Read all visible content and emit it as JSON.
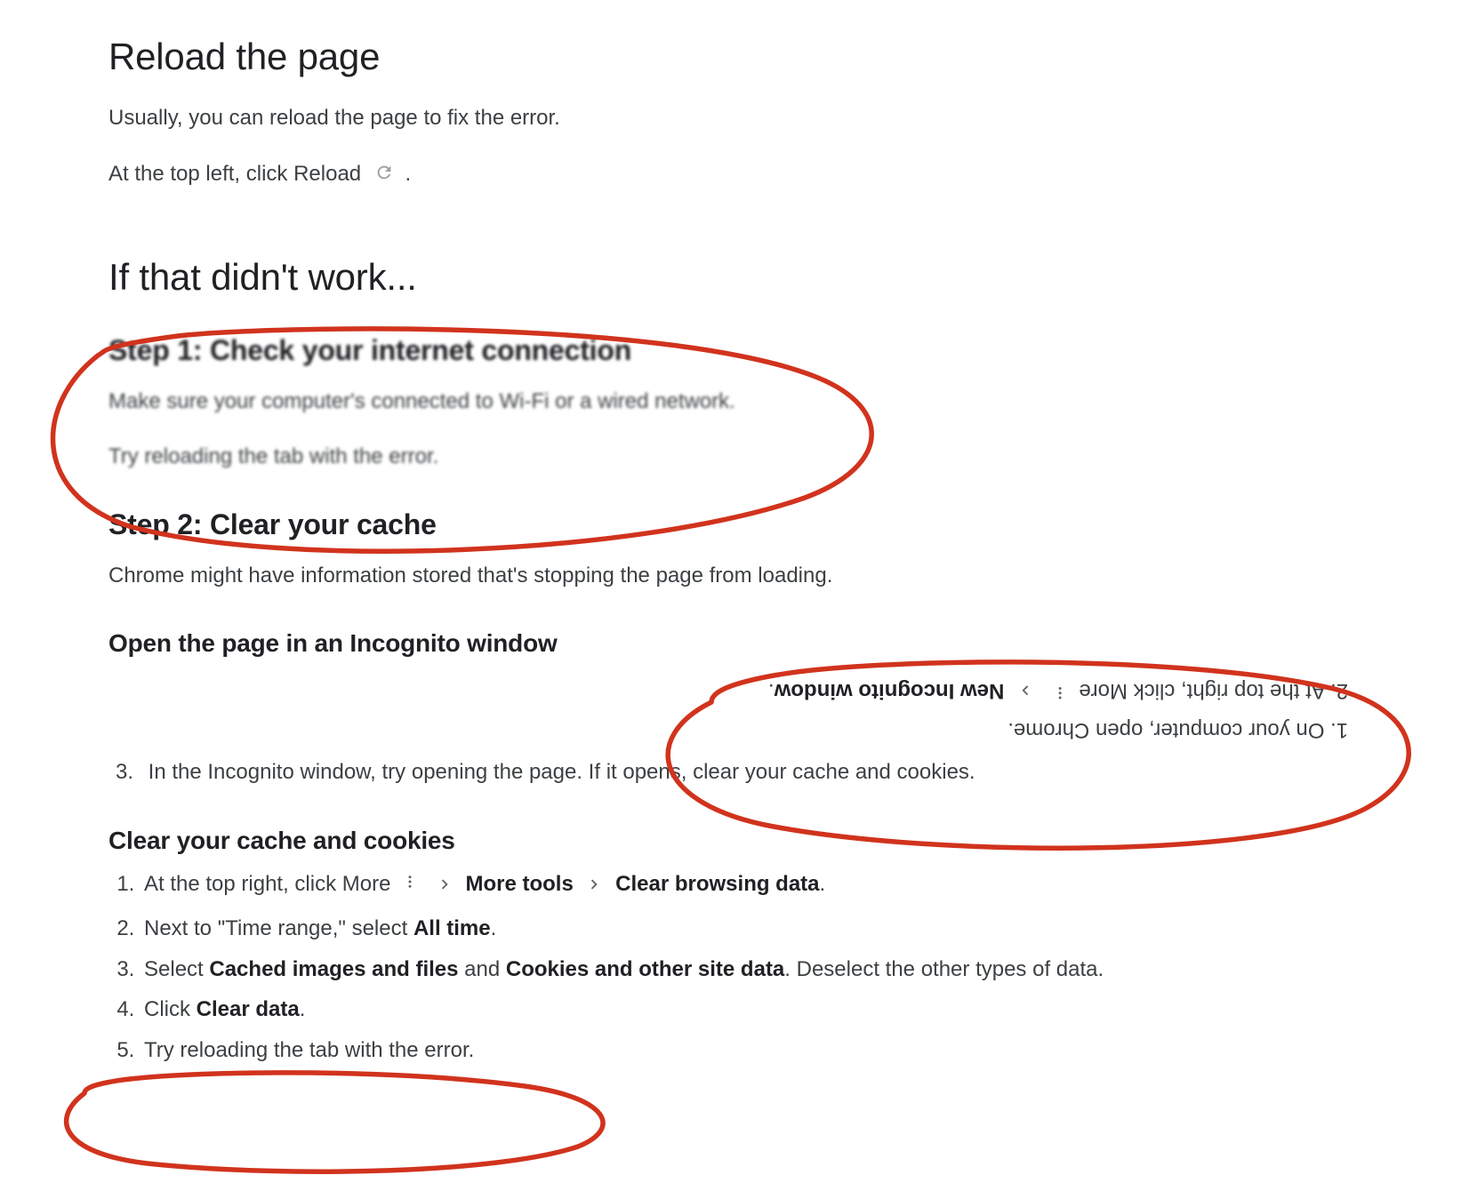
{
  "heading_reload": "Reload the page",
  "reload_p1": "Usually, you can reload the page to fix the error.",
  "reload_p2a": "At the top left, click Reload ",
  "reload_p2b": ".",
  "heading_fallback": "If that didn't work...",
  "step1_title": "Step 1: Check your internet connection",
  "step1_p1": "Make sure your computer's connected to Wi-Fi or a wired network.",
  "step1_p2": "Try reloading the tab with the error.",
  "step2_title": "Step 2: Clear your cache",
  "step2_p1": "Chrome might have information stored that's stopping the page from loading.",
  "incog_title": "Open the page in an Incognito window",
  "incog_li1": "On your computer, open Chrome.",
  "incog_li2a": "At the top right, click More ",
  "incog_li2b": " New Incognito window",
  "incog_li2c": ".",
  "incog_li3": "In the Incognito window, try opening the page. If it opens, clear your cache and cookies.",
  "clear_title": "Clear your cache and cookies",
  "clear_li1a": "At the top right, click More ",
  "clear_li1b": "More tools",
  "clear_li1c": "Clear browsing data",
  "clear_li1d": ".",
  "clear_li2a": "Next to \"Time range,\" select ",
  "clear_li2b": "All time",
  "clear_li2c": ".",
  "clear_li3a": "Select ",
  "clear_li3b": "Cached images and files",
  "clear_li3c": " and ",
  "clear_li3d": "Cookies and other site data",
  "clear_li3e": ". Deselect the other types of data.",
  "clear_li4a": "Click ",
  "clear_li4b": "Clear data",
  "clear_li4c": ".",
  "clear_li5": "Try reloading the tab with the error.",
  "num1": "1.",
  "num2": "2.",
  "num3": "3."
}
